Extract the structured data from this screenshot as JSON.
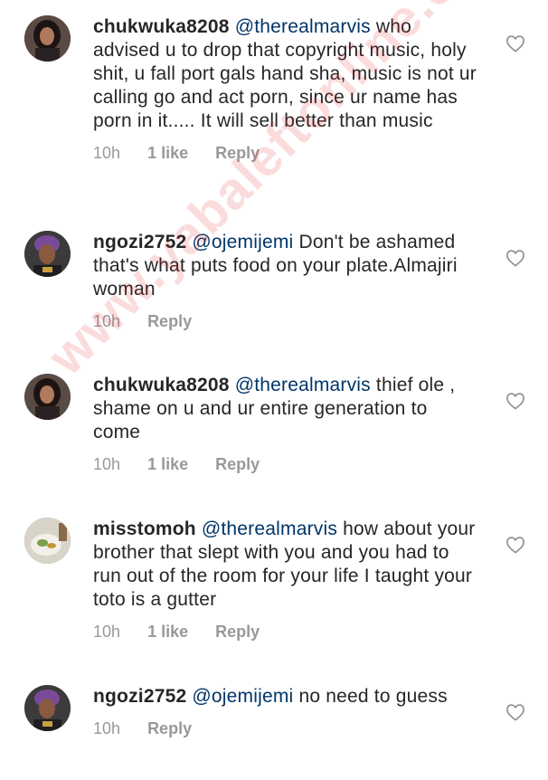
{
  "comments": [
    {
      "username": "chukwuka8208",
      "mention": "@therealmarvis",
      "text": "who advised u to drop that copyright music, holy shit, u fall port gals hand sha, music is not ur calling go and act porn, since ur name has porn in it..... It will sell better than music",
      "time": "10h",
      "likes": "1 like",
      "reply": "Reply",
      "avatar_icon": "profile-photo-woman-dark-hair"
    },
    {
      "username": "ngozi2752",
      "mention": "@ojemijemi",
      "text": "Don't be ashamed that's what puts food on your plate.Almajiri woman",
      "time": "10h",
      "likes": "",
      "reply": "Reply",
      "avatar_icon": "profile-photo-woman-purple-headwrap"
    },
    {
      "username": "chukwuka8208",
      "mention": "@therealmarvis",
      "text": "thief ole , shame on u and ur entire generation to come",
      "time": "10h",
      "likes": "1 like",
      "reply": "Reply",
      "avatar_icon": "profile-photo-woman-dark-hair"
    },
    {
      "username": "misstomoh",
      "mention": "@therealmarvis",
      "text": "how about your brother that slept with you and you had to run out of the room for your life I taught your toto is a gutter",
      "time": "10h",
      "likes": "1 like",
      "reply": "Reply",
      "avatar_icon": "profile-photo-food-plate"
    },
    {
      "username": "ngozi2752",
      "mention": "@ojemijemi",
      "text": "no need to guess",
      "time": "10h",
      "likes": "",
      "reply": "Reply",
      "avatar_icon": "profile-photo-woman-purple-headwrap"
    }
  ],
  "watermark": "www.yabaleftonline.com",
  "colors": {
    "text": "#262626",
    "mention": "#003569",
    "meta": "#999999",
    "watermark": "#e62828"
  }
}
